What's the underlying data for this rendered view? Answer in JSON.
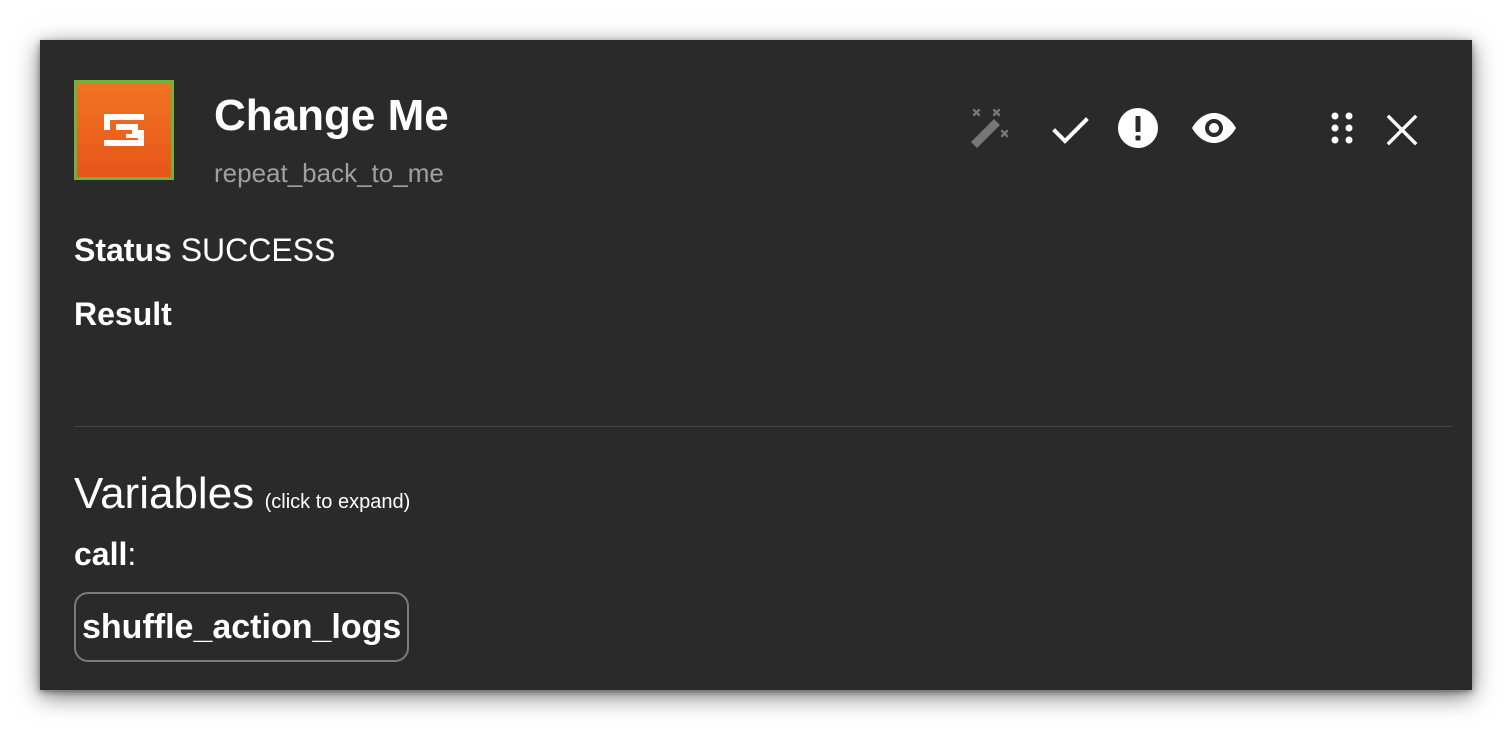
{
  "header": {
    "title": "Change Me",
    "subtitle": "repeat_back_to_me",
    "app_icon": "shuffle-logo-icon",
    "brand_color": "#e8551a",
    "border_color": "#6fb33a"
  },
  "toolbar": {
    "icons": [
      "magic-wand-icon",
      "checkmark-icon",
      "alert-circle-icon",
      "eye-icon",
      "drag-handle-icon",
      "close-icon"
    ]
  },
  "status": {
    "label": "Status",
    "value": "SUCCESS"
  },
  "result": {
    "label": "Result"
  },
  "variables": {
    "heading": "Variables",
    "hint": "(click to expand)",
    "key": "call",
    "separator": ":",
    "value": "shuffle_action_logs"
  }
}
